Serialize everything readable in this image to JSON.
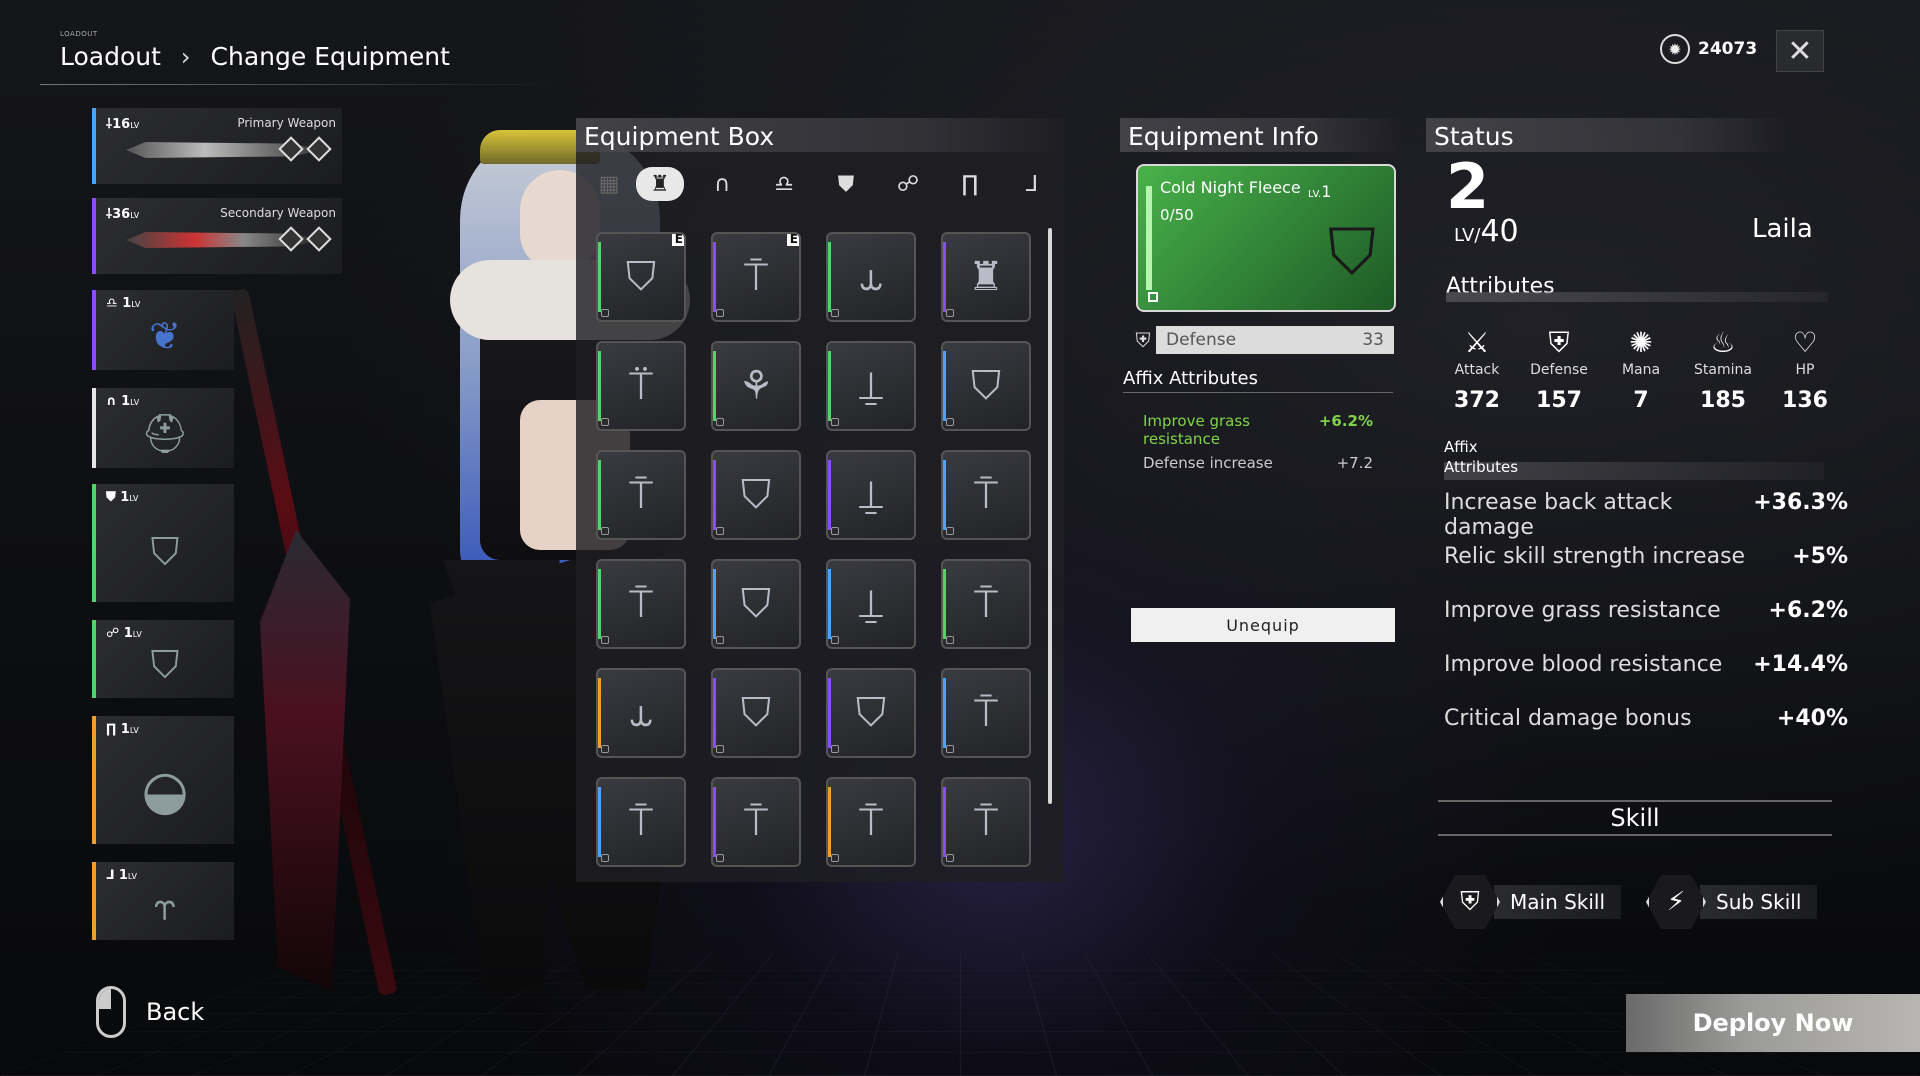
{
  "header": {
    "small_label": "LOADOUT",
    "breadcrumb": [
      "Loadout",
      "Change Equipment"
    ],
    "currency_value": "24073"
  },
  "loadout_slots": [
    {
      "level": "16",
      "lv_suffix": "LV",
      "type": "Primary Weapon",
      "color": "#4aa3ff"
    },
    {
      "level": "36",
      "lv_suffix": "LV",
      "type": "Secondary Weapon",
      "color": "#8a4cff"
    },
    {
      "level": "1",
      "lv_suffix": "LV",
      "type": "",
      "color": "#8a4cff"
    },
    {
      "level": "1",
      "lv_suffix": "LV",
      "type": "",
      "color": "#e6e6e6"
    },
    {
      "level": "1",
      "lv_suffix": "LV",
      "type": "",
      "color": "#54d36a"
    },
    {
      "level": "1",
      "lv_suffix": "LV",
      "type": "",
      "color": "#54d36a"
    },
    {
      "level": "1",
      "lv_suffix": "LV",
      "type": "",
      "color": "#f0a02a"
    },
    {
      "level": "1",
      "lv_suffix": "LV",
      "type": "",
      "color": "#f0a02a"
    }
  ],
  "equipment_box": {
    "title": "Equipment Box",
    "tabs": [
      "grid-icon",
      "body-icon",
      "hood-icon",
      "hair-icon",
      "chest-icon",
      "arm-icon",
      "legs-icon",
      "boots-icon"
    ],
    "equipped_marker": "E",
    "items": [
      {
        "color": "#54d36a",
        "equipped": true
      },
      {
        "color": "#8a4cff",
        "equipped": true
      },
      {
        "color": "#54d36a",
        "equipped": false
      },
      {
        "color": "#8a4cff",
        "equipped": false
      },
      {
        "color": "#54d36a",
        "equipped": false
      },
      {
        "color": "#54d36a",
        "equipped": false
      },
      {
        "color": "#54d36a",
        "equipped": false
      },
      {
        "color": "#4aa3ff",
        "equipped": false
      },
      {
        "color": "#54d36a",
        "equipped": false
      },
      {
        "color": "#8a4cff",
        "equipped": false
      },
      {
        "color": "#8a4cff",
        "equipped": false
      },
      {
        "color": "#4aa3ff",
        "equipped": false
      },
      {
        "color": "#54d36a",
        "equipped": false
      },
      {
        "color": "#4aa3ff",
        "equipped": false
      },
      {
        "color": "#4aa3ff",
        "equipped": false
      },
      {
        "color": "#54d36a",
        "equipped": false
      },
      {
        "color": "#f0a02a",
        "equipped": false
      },
      {
        "color": "#8a4cff",
        "equipped": false
      },
      {
        "color": "#8a4cff",
        "equipped": false
      },
      {
        "color": "#4aa3ff",
        "equipped": false
      },
      {
        "color": "#4aa3ff",
        "equipped": false
      },
      {
        "color": "#8a4cff",
        "equipped": false
      },
      {
        "color": "#f0a02a",
        "equipped": false
      },
      {
        "color": "#8a4cff",
        "equipped": false
      }
    ]
  },
  "equipment_info": {
    "title": "Equipment Info",
    "item_name": "Cold Night Fleece",
    "lv_prefix": "LV.",
    "level": "1",
    "count": "0/50",
    "stat_label": "Defense",
    "stat_value": "33",
    "affix_title": "Affix Attributes",
    "affixes": [
      {
        "name": "Improve grass resistance",
        "value": "+6.2%"
      },
      {
        "name": "Defense increase",
        "value": "+7.2"
      }
    ],
    "unequip_label": "Unequip"
  },
  "status": {
    "title": "Status",
    "level": "2",
    "max_level_prefix": "LV/",
    "max_level": "40",
    "character_name": "Laila",
    "attributes_title": "Attributes",
    "attributes": [
      {
        "name": "Attack",
        "value": "372",
        "icon": "attack-icon"
      },
      {
        "name": "Defense",
        "value": "157",
        "icon": "defense-icon"
      },
      {
        "name": "Mana",
        "value": "7",
        "icon": "mana-icon"
      },
      {
        "name": "Stamina",
        "value": "185",
        "icon": "stamina-icon"
      },
      {
        "name": "HP",
        "value": "136",
        "icon": "hp-icon"
      }
    ],
    "affix_line1": "Affix",
    "affix_line2": "Attributes",
    "affix_stats": [
      {
        "name": "Increase back attack damage",
        "value": "+36.3%"
      },
      {
        "name": "Relic skill strength increase",
        "value": "+5%"
      },
      {
        "name": "Improve grass resistance",
        "value": "+6.2%"
      },
      {
        "name": "Improve blood resistance",
        "value": "+14.4%"
      },
      {
        "name": "Critical damage bonus",
        "value": "+40%"
      }
    ],
    "skill_title": "Skill",
    "main_skill": "Main Skill",
    "sub_skill": "Sub Skill"
  },
  "footer": {
    "back_label": "Back",
    "deploy_label": "Deploy Now"
  }
}
